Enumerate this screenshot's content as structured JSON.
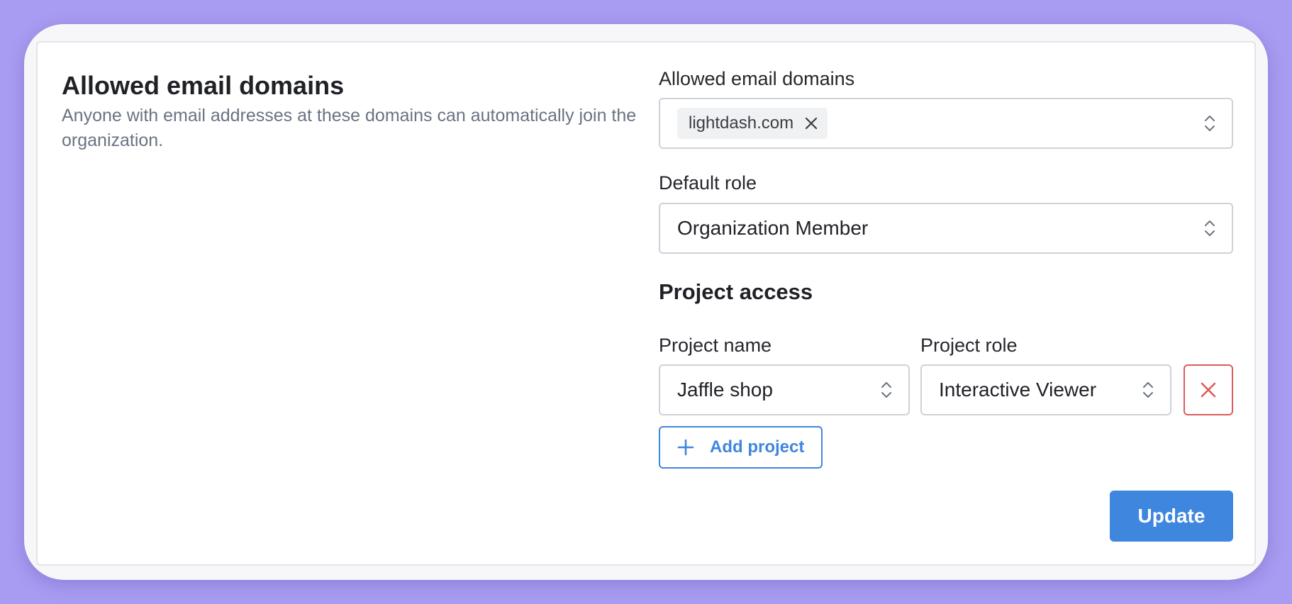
{
  "section": {
    "title": "Allowed email domains",
    "description": "Anyone with email addresses at these domains can automatically join the organization."
  },
  "domains_field": {
    "label": "Allowed email domains",
    "chips": [
      "lightdash.com"
    ]
  },
  "default_role_field": {
    "label": "Default role",
    "value": "Organization Member"
  },
  "project_access": {
    "heading": "Project access",
    "name_label": "Project name",
    "role_label": "Project role",
    "rows": [
      {
        "project": "Jaffle shop",
        "role": "Interactive Viewer"
      }
    ],
    "add_label": "Add project"
  },
  "actions": {
    "update_label": "Update"
  },
  "colors": {
    "accent": "#3f86de",
    "danger": "#e05a5a",
    "background": "#a89cf2"
  }
}
